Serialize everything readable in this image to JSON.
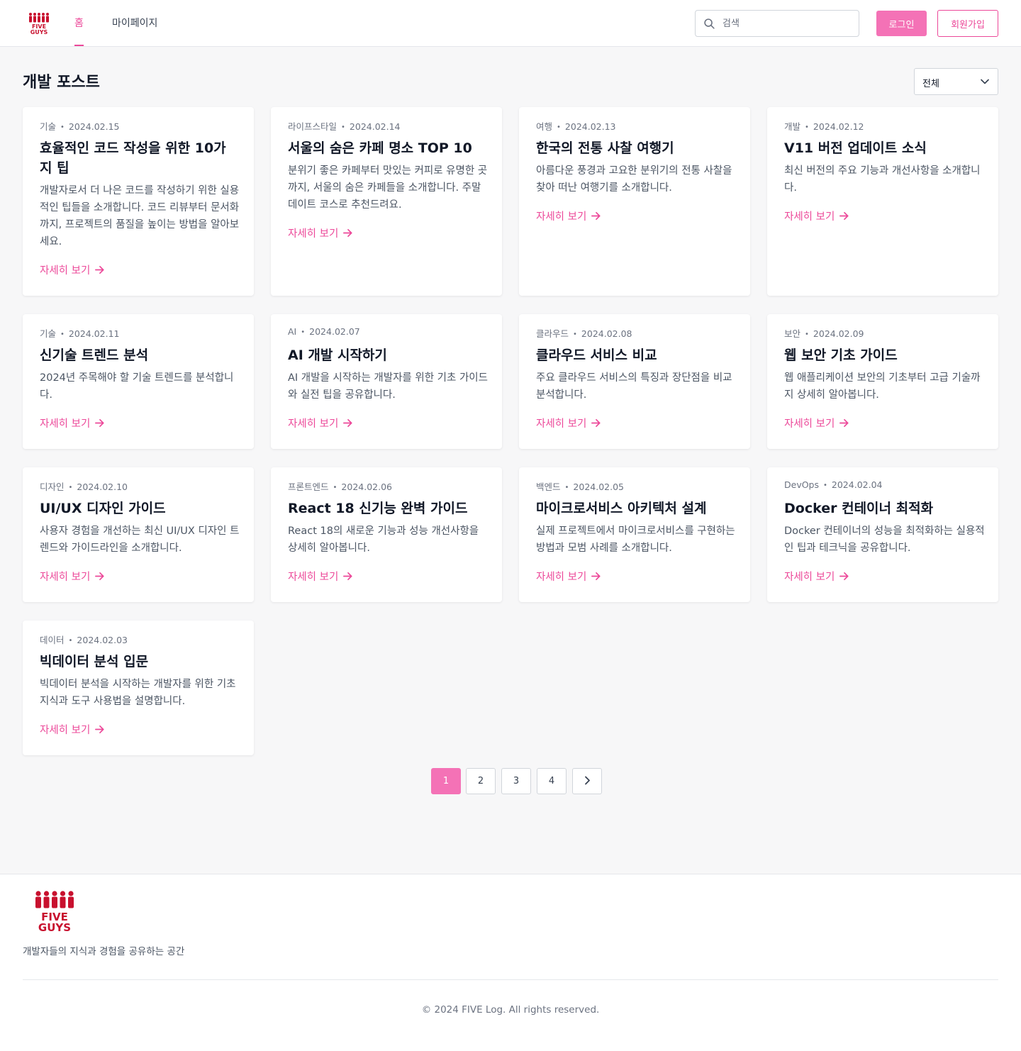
{
  "header": {
    "logo_text": [
      "FIVE",
      "GUYS"
    ],
    "tabs": [
      {
        "label": "홈",
        "active": true
      },
      {
        "label": "마이페이지",
        "active": false
      }
    ],
    "search_placeholder": "검색",
    "login_label": "로그인",
    "signup_label": "회원가입"
  },
  "main": {
    "title": "개발 포스트",
    "filter_selected": "전체",
    "read_more_label": "자세히 보기",
    "posts": [
      {
        "category": "기술",
        "date": "2024.02.15",
        "title": "효율적인 코드 작성을 위한 10가지 팁",
        "excerpt": "개발자로서 더 나은 코드를 작성하기 위한 실용적인 팁들을 소개합니다. 코드 리뷰부터 문서화까지, 프로젝트의 품질을 높이는 방법을 알아보세요."
      },
      {
        "category": "라이프스타일",
        "date": "2024.02.14",
        "title": "서울의 숨은 카페 명소 TOP 10",
        "excerpt": "분위기 좋은 카페부터 맛있는 커피로 유명한 곳까지, 서울의 숨은 카페들을 소개합니다. 주말 데이트 코스로 추천드려요."
      },
      {
        "category": "여행",
        "date": "2024.02.13",
        "title": "한국의 전통 사찰 여행기",
        "excerpt": "아름다운 풍경과 고요한 분위기의 전통 사찰을 찾아 떠난 여행기를 소개합니다."
      },
      {
        "category": "개발",
        "date": "2024.02.12",
        "title": "V11 버전 업데이트 소식",
        "excerpt": "최신 버전의 주요 기능과 개선사항을 소개합니다."
      },
      {
        "category": "기술",
        "date": "2024.02.11",
        "title": "신기술 트렌드 분석",
        "excerpt": "2024년 주목해야 할 기술 트렌드를 분석합니다."
      },
      {
        "category": "AI",
        "date": "2024.02.07",
        "title": "AI 개발 시작하기",
        "excerpt": "AI 개발을 시작하는 개발자를 위한 기초 가이드와 실전 팁을 공유합니다."
      },
      {
        "category": "클라우드",
        "date": "2024.02.08",
        "title": "클라우드 서비스 비교",
        "excerpt": "주요 클라우드 서비스의 특징과 장단점을 비교 분석합니다."
      },
      {
        "category": "보안",
        "date": "2024.02.09",
        "title": "웹 보안 기초 가이드",
        "excerpt": "웹 애플리케이션 보안의 기초부터 고급 기술까지 상세히 알아봅니다."
      },
      {
        "category": "디자인",
        "date": "2024.02.10",
        "title": "UI/UX 디자인 가이드",
        "excerpt": "사용자 경험을 개선하는 최신 UI/UX 디자인 트렌드와 가이드라인을 소개합니다."
      },
      {
        "category": "프론트엔드",
        "date": "2024.02.06",
        "title": "React 18 신기능 완벽 가이드",
        "excerpt": "React 18의 새로운 기능과 성능 개선사항을 상세히 알아봅니다."
      },
      {
        "category": "백엔드",
        "date": "2024.02.05",
        "title": "마이크로서비스 아키텍처 설계",
        "excerpt": "실제 프로젝트에서 마이크로서비스를 구현하는 방법과 모범 사례를 소개합니다."
      },
      {
        "category": "DevOps",
        "date": "2024.02.04",
        "title": "Docker 컨테이너 최적화",
        "excerpt": "Docker 컨테이너의 성능을 최적화하는 실용적인 팁과 테크닉을 공유합니다."
      },
      {
        "category": "데이터",
        "date": "2024.02.03",
        "title": "빅데이터 분석 입문",
        "excerpt": "빅데이터 분석을 시작하는 개발자를 위한 기초 지식과 도구 사용법을 설명합니다."
      }
    ]
  },
  "pagination": {
    "pages": [
      "1",
      "2",
      "3",
      "4"
    ],
    "current": "1",
    "next_icon": "chevron-right-icon"
  },
  "footer": {
    "tagline": "개발자들의 지식과 경험을 공유하는 공간",
    "copyright": "© 2024 FIVE Log. All rights reserved."
  },
  "colors": {
    "accent": "#ec4899",
    "accent_light": "#f472b6",
    "logo_red": "#c8102e"
  }
}
